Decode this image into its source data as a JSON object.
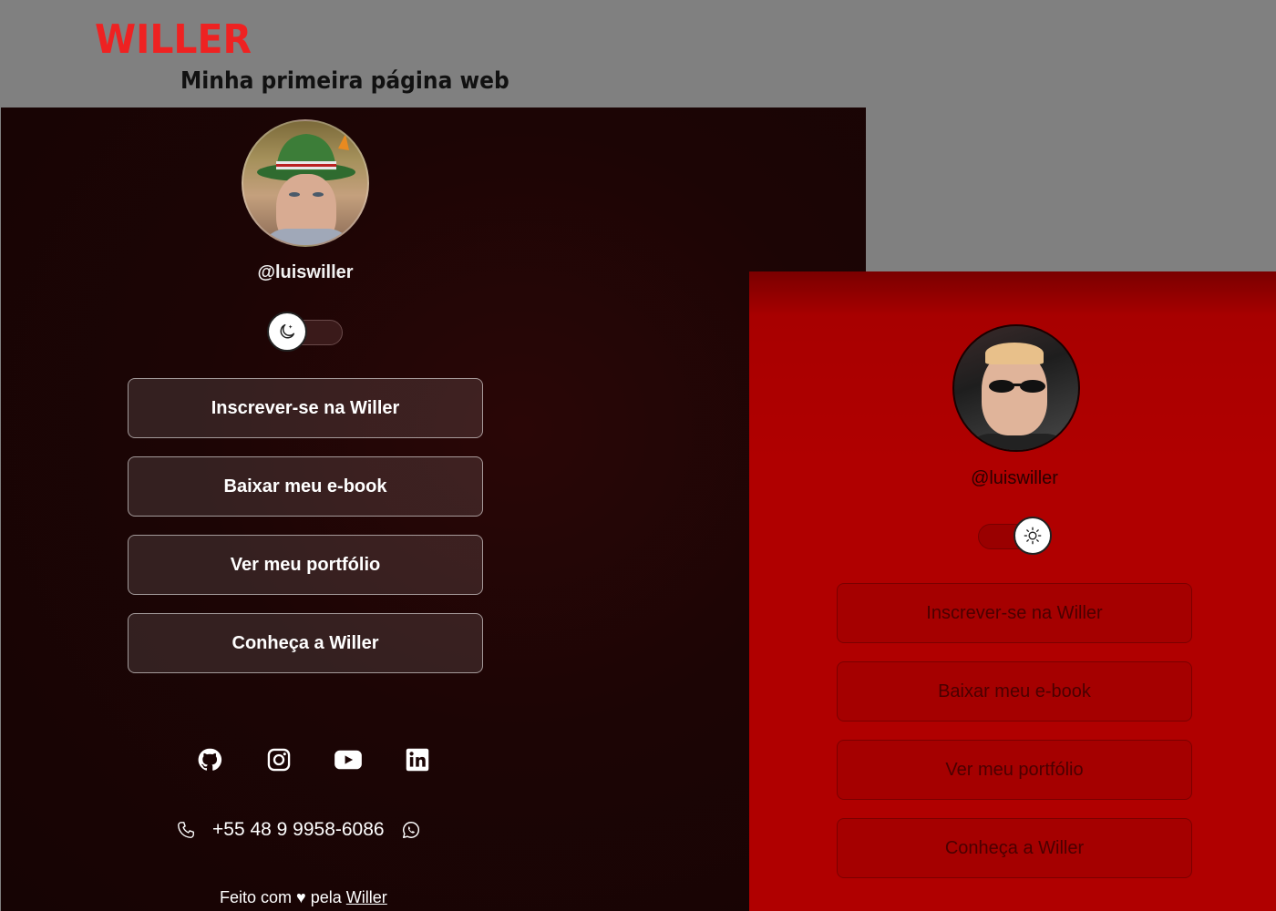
{
  "header": {
    "title": "WILLER",
    "subtitle": "Minha primeira página web"
  },
  "dark_profile": {
    "avatar_alt": "avatar",
    "handle": "@luiswiller",
    "theme_toggle_icon": "moon-icon",
    "links": [
      {
        "label": "Inscrever-se na Willer"
      },
      {
        "label": "Baixar meu e-book"
      },
      {
        "label": "Ver meu portfólio"
      },
      {
        "label": "Conheça a Willer"
      }
    ],
    "social": [
      "github-icon",
      "instagram-icon",
      "youtube-icon",
      "linkedin-icon"
    ],
    "phone": "+55 48 9 9958-6086",
    "footer": {
      "prefix": "Feito com",
      "heart": "♥",
      "middle": "pela",
      "link": "Willer"
    }
  },
  "light_profile": {
    "handle": "@luiswiller",
    "theme_toggle_icon": "sun-icon",
    "links": [
      {
        "label": "Inscrever-se na Willer"
      },
      {
        "label": "Baixar meu e-book"
      },
      {
        "label": "Ver meu portfólio"
      },
      {
        "label": "Conheça a Willer"
      }
    ]
  },
  "colors": {
    "page_background": "#808080",
    "title": "#ee2222",
    "dark_panel": "#1c0505",
    "red_panel": "#b00000"
  }
}
